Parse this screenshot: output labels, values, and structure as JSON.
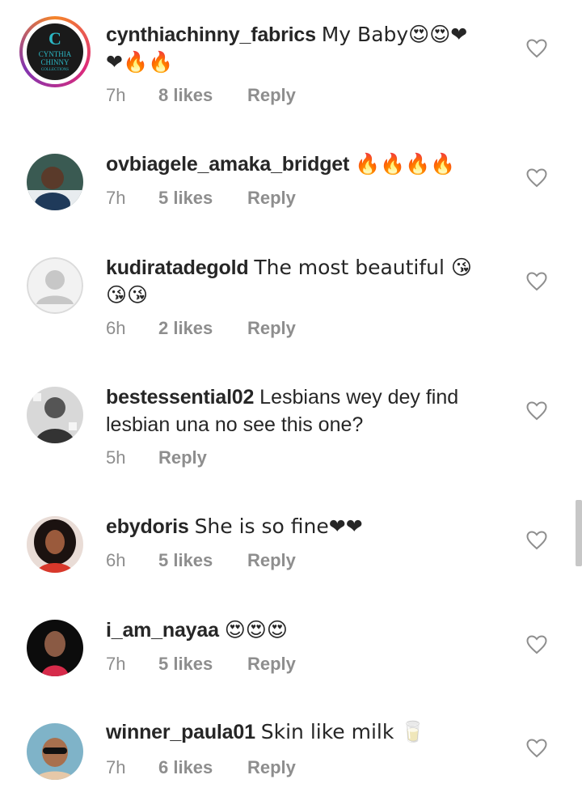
{
  "comments": [
    {
      "username": "cynthiachinny_fabrics",
      "text": "My Baby😍😍❤",
      "text2": "❤🔥🔥",
      "time": "7h",
      "likes": "8 likes",
      "reply": "Reply",
      "avatar_text": "CYNTHIA CHINNY",
      "avatar_sub": "COLLECTIONS",
      "avatar_letter": "C"
    },
    {
      "username": "ovbiagele_amaka_bridget",
      "text": "🔥🔥🔥🔥",
      "time": "7h",
      "likes": "5 likes",
      "reply": "Reply"
    },
    {
      "username": "kudiratadegold",
      "text": "The most beautiful 😘",
      "text2": "😘😘",
      "time": "6h",
      "likes": "2 likes",
      "reply": "Reply"
    },
    {
      "username": "bestessential02",
      "text": "Lesbians wey dey find",
      "text2": "lesbian una no see this one?",
      "time": "5h",
      "reply": "Reply"
    },
    {
      "username": "ebydoris",
      "text": "She is so fine❤❤",
      "time": "6h",
      "likes": "5 likes",
      "reply": "Reply"
    },
    {
      "username": "i_am_nayaa",
      "text": "😍😍😍",
      "time": "7h",
      "likes": "5 likes",
      "reply": "Reply"
    },
    {
      "username": "winner_paula01",
      "text": "Skin like milk 🥛",
      "time": "7h",
      "likes": "6 likes",
      "reply": "Reply"
    }
  ],
  "colors": {
    "text": "#262626",
    "meta": "#8e8e8e",
    "heart_stroke": "#8e8e8e",
    "ring_start": "#f58529",
    "ring_end": "#8134af"
  }
}
